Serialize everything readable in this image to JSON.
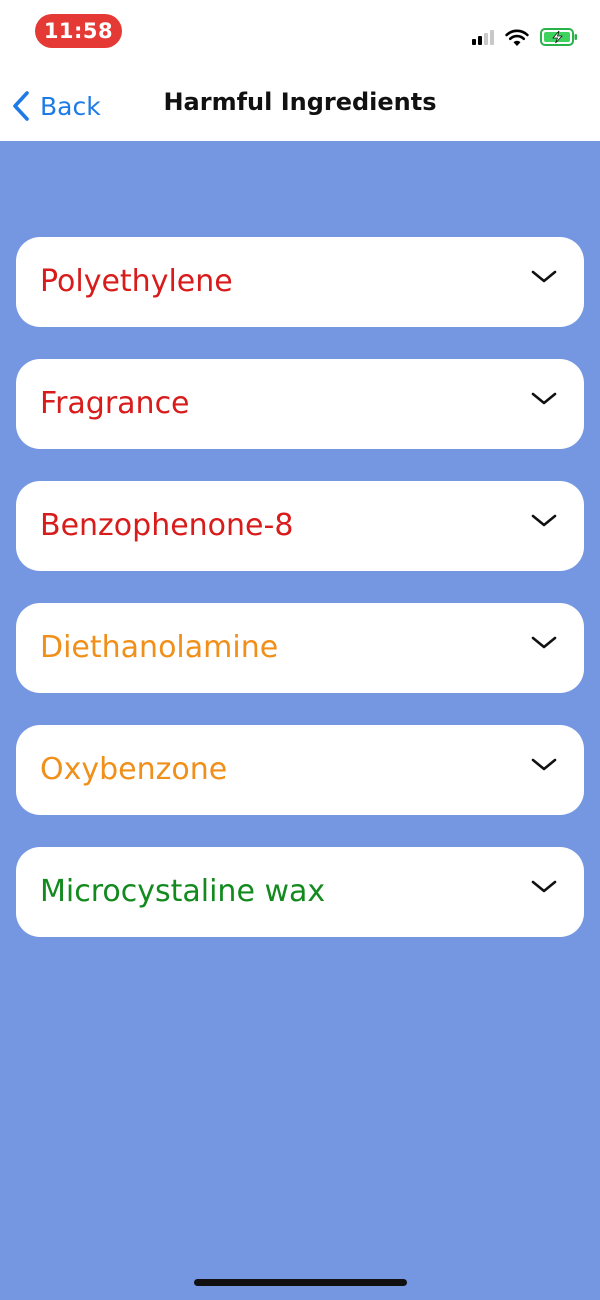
{
  "status_bar": {
    "time": "11:58",
    "time_pill_color": "#e53935",
    "icons": [
      "cellular-signal-icon",
      "wifi-icon",
      "battery-charging-icon"
    ]
  },
  "nav": {
    "back_label": "Back",
    "title": "Harmful Ingredients"
  },
  "colors": {
    "background": "#7596e1",
    "back_link": "#1e7be6",
    "high_risk": "#d81b1b",
    "medium_risk": "#f0901a",
    "low_risk": "#138a1e"
  },
  "ingredients": [
    {
      "name": "Polyethylene",
      "color": "#d81b1b"
    },
    {
      "name": "Fragrance",
      "color": "#d81b1b"
    },
    {
      "name": "Benzophenone-8",
      "color": "#d81b1b"
    },
    {
      "name": "Diethanolamine",
      "color": "#f0901a"
    },
    {
      "name": "Oxybenzone",
      "color": "#f0901a"
    },
    {
      "name": "Microcystaline wax",
      "color": "#138a1e"
    }
  ]
}
